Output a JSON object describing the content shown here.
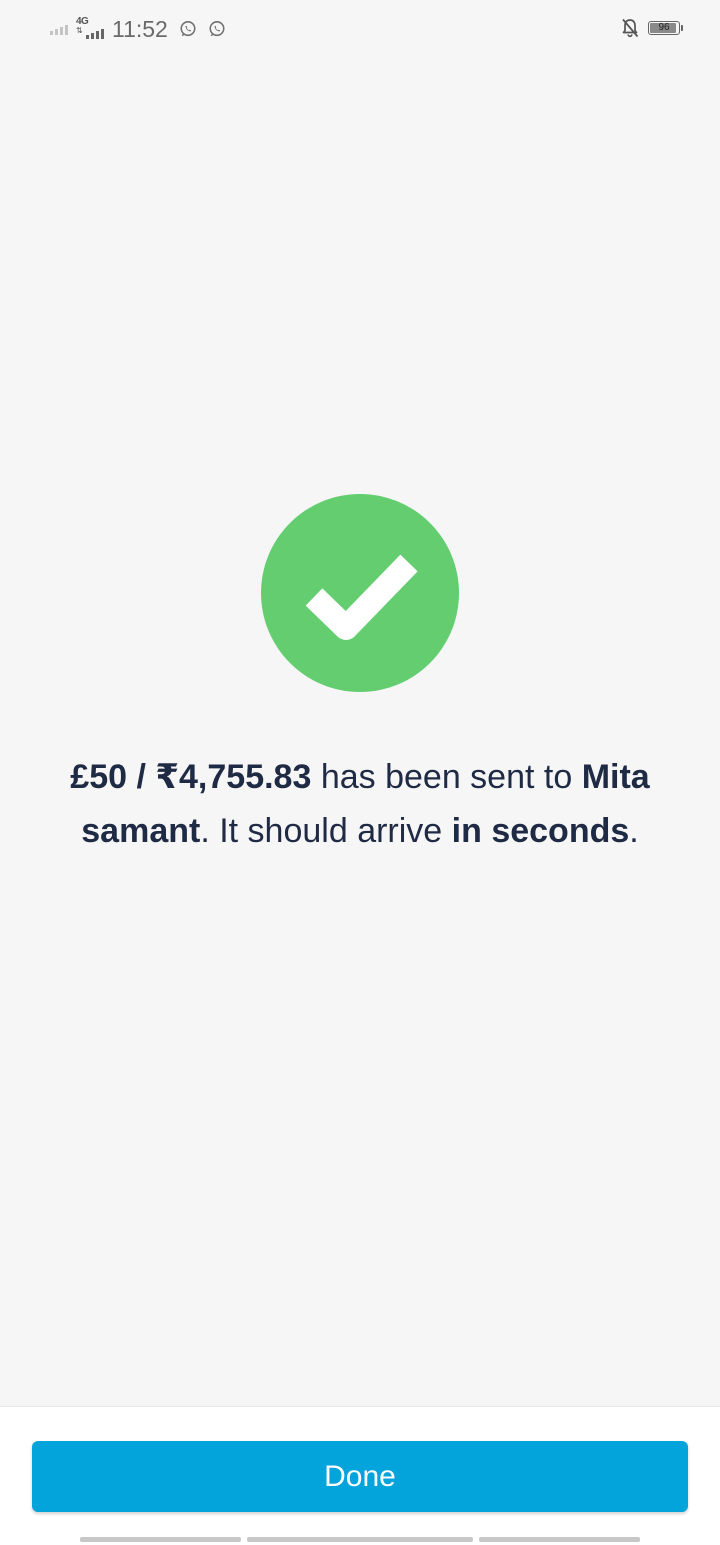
{
  "status_bar": {
    "network_type": "4G",
    "time": "11:52",
    "battery_level": "96",
    "icons": [
      "signal-icon",
      "network-4g-icon",
      "whatsapp-icon",
      "whatsapp-icon",
      "notifications-off-icon",
      "battery-icon"
    ]
  },
  "success": {
    "icon": "check-circle-icon",
    "color": "#63cd70",
    "message_parts": {
      "amount": "£50 / ₹4,755.83",
      "text1": " has been sent to ",
      "recipient": "Mita samant",
      "text2": ". It should arrive ",
      "timing": "in seconds",
      "text3": "."
    }
  },
  "footer": {
    "done_label": "Done",
    "button_color": "#03a3db"
  }
}
